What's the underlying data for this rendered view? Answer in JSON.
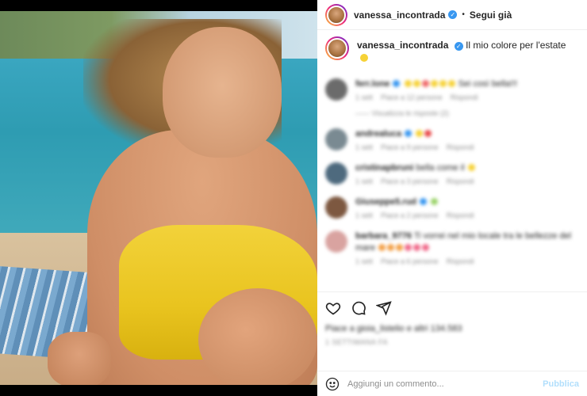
{
  "post": {
    "username": "vanessa_incontrada",
    "follow_label": "Segui già",
    "dot": "•",
    "caption_text": "Il mio colore per l'estate"
  },
  "comments": [
    {
      "user": "ferr.lone",
      "text": "Sei così bella!!!",
      "meta1": "1 sett",
      "meta2": "Piace a 12 persone",
      "meta3": "Rispondi",
      "replies": "—— Visualizza le risposte (2)",
      "avatar_color": "#6b6b6b"
    },
    {
      "user": "andrealuca",
      "text": "",
      "meta1": "1 sett",
      "meta2": "Piace a 9 persone",
      "meta3": "Rispondi",
      "replies": "",
      "avatar_color": "#7a8a92"
    },
    {
      "user": "cristinapbruni",
      "text": "bella come il",
      "meta1": "1 sett",
      "meta2": "Piace a 3 persone",
      "meta3": "Rispondi",
      "replies": "",
      "avatar_color": "#4e6a7e"
    },
    {
      "user": "Giuseppe5.rud",
      "text": "",
      "meta1": "1 sett",
      "meta2": "Piace a 2 persone",
      "meta3": "Rispondi",
      "replies": "",
      "avatar_color": "#7d5840"
    },
    {
      "user": "barbara_9776",
      "text": "Ti vorrei nel mio locale tra le bellezze del mare",
      "meta1": "1 sett",
      "meta2": "Piace a 6 persone",
      "meta3": "Rispondi",
      "replies": "",
      "avatar_color": "#d9a3a0"
    }
  ],
  "actions": {
    "likes": "Piace a gioia_listelio e altri 134.583",
    "time": "1 SETTIMANA FA"
  },
  "composer": {
    "placeholder": "Aggiungi un commento...",
    "publish_label": "Pubblica"
  },
  "colors": {
    "verified": "#3897f0",
    "publish": "#b2dffc",
    "meta": "#8e8e8e"
  },
  "icons": [
    "heart-icon",
    "comment-icon",
    "share-icon",
    "emoji-icon",
    "verified-icon"
  ]
}
